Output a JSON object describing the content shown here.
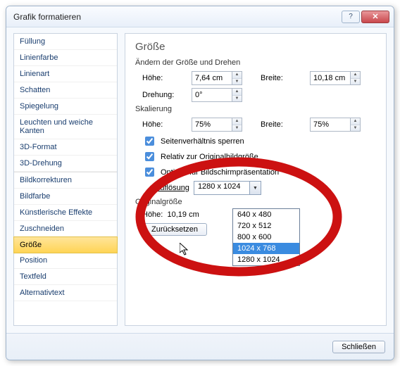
{
  "dialog": {
    "title": "Grafik formatieren"
  },
  "sidebar": {
    "items": [
      "Füllung",
      "Linienfarbe",
      "Linienart",
      "Schatten",
      "Spiegelung",
      "Leuchten und weiche Kanten",
      "3D-Format",
      "3D-Drehung",
      "Bildkorrekturen",
      "Bildfarbe",
      "Künstlerische Effekte",
      "Zuschneiden",
      "Größe",
      "Position",
      "Textfeld",
      "Alternativtext"
    ],
    "selected_index": 12
  },
  "content": {
    "heading": "Größe",
    "section_resize": "Ändern der Größe und Drehen",
    "height_label": "Höhe:",
    "width_label": "Breite:",
    "rotation_label": "Drehung:",
    "height_value": "7,64 cm",
    "width_value": "10,18 cm",
    "rotation_value": "0°",
    "section_scale": "Skalierung",
    "scale_height_label": "Höhe:",
    "scale_width_label": "Breite:",
    "scale_height_value": "75%",
    "scale_width_value": "75%",
    "cb_lock_aspect": "Seitenverhältnis sperren",
    "cb_relative_orig": "Relativ zur Originalbildgröße",
    "cb_optimal_screen": "Optimal für Bildschirmpräsentation",
    "cb_lock_checked": true,
    "cb_relative_checked": true,
    "cb_optimal_checked": true,
    "resolution_label": "Auflösung",
    "resolution_value": "1280 x 1024",
    "resolution_options": [
      "640 x 480",
      "720 x 512",
      "800 x 600",
      "1024 x 768",
      "1280 x 1024"
    ],
    "resolution_highlight_index": 3,
    "section_orig": "Originalgröße",
    "orig_height_label": "Höhe:",
    "orig_height_value": "10,19 cm",
    "reset_button": "Zurücksetzen"
  },
  "footer": {
    "close_button": "Schließen"
  }
}
